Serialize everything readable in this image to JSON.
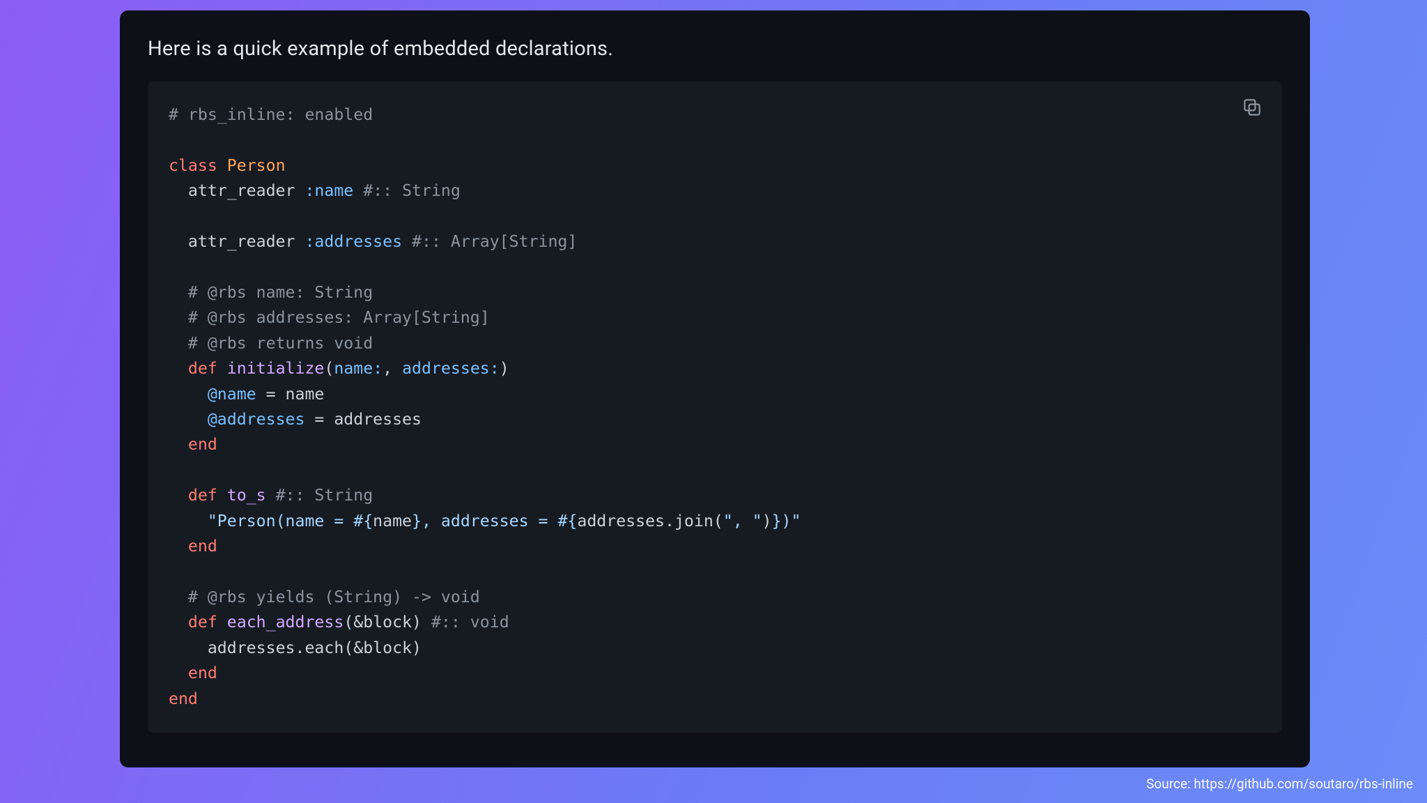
{
  "intro": "Here is a quick example of embedded declarations.",
  "source_label": "Source: https://github.com/soutaro/rbs-inline",
  "copy_icon_name": "copy-icon",
  "code": {
    "l01": "# rbs_inline: enabled",
    "l03_class": "class",
    "l03_name": "Person",
    "l04_attr": "attr_reader",
    "l04_sym": ":name",
    "l04_cmt": "#:: String",
    "l06_attr": "attr_reader",
    "l06_sym": ":addresses",
    "l06_cmt": "#:: Array[String]",
    "l08": "# @rbs name: String",
    "l09": "# @rbs addresses: Array[String]",
    "l10": "# @rbs returns void",
    "l11_def": "def",
    "l11_m": "initialize",
    "l11_p": "(",
    "l11_k1": "name:",
    "l11_c": ", ",
    "l11_k2": "addresses:",
    "l11_pe": ")",
    "l12_ivar": "@name",
    "l12_eq": " = name",
    "l13_ivar": "@addresses",
    "l13_eq": " = addresses",
    "l14_end": "end",
    "l16_def": "def",
    "l16_m": "to_s",
    "l16_cmt": "#:: String",
    "l17_q1": "\"Person(name = ",
    "l17_i1o": "#{",
    "l17_i1b": "name",
    "l17_i1c": "}",
    "l17_m": ", addresses = ",
    "l17_i2o": "#{",
    "l17_i2b": "addresses.join(",
    "l17_i2s": "\", \"",
    "l17_i2e": ")",
    "l17_i2c": "}",
    "l17_q2": ")\"",
    "l18_end": "end",
    "l20": "# @rbs yields (String) -> void",
    "l21_def": "def",
    "l21_m": "each_address",
    "l21_args": "(&block)",
    "l21_cmt": "#:: void",
    "l22": "addresses.each(&block)",
    "l23_end": "end",
    "l24_end": "end"
  }
}
